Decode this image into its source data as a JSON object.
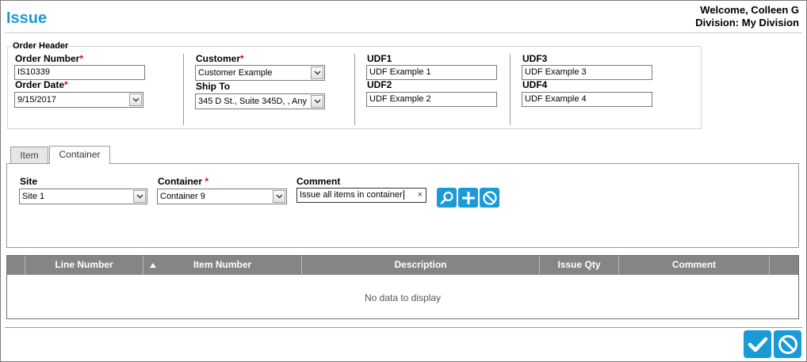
{
  "page": {
    "title": "Issue",
    "welcome": "Welcome, Colleen G",
    "division": "Division: My Division"
  },
  "order_header": {
    "legend": "Order Header",
    "order_number_label": "Order Number",
    "order_number": "IS10339",
    "order_date_label": "Order Date",
    "order_date": "9/15/2017",
    "customer_label": "Customer",
    "customer": "Customer Example",
    "ship_to_label": "Ship To",
    "ship_to": "345 D St., Suite 345D, , Any",
    "udf1_label": "UDF1",
    "udf1": "UDF Example 1",
    "udf2_label": "UDF2",
    "udf2": "UDF Example 2",
    "udf3_label": "UDF3",
    "udf3": "UDF Example 3",
    "udf4_label": "UDF4",
    "udf4": "UDF Example 4",
    "required_marker": "*"
  },
  "tabs": [
    {
      "label": "Item",
      "active": false
    },
    {
      "label": "Container",
      "active": true
    }
  ],
  "container_tab": {
    "site_label": "Site",
    "site": "Site 1",
    "container_label": "Container",
    "container": "Container 9",
    "comment_label": "Comment",
    "comment": "Issue all items in container",
    "clear_glyph": "×"
  },
  "grid": {
    "columns": [
      "Line Number",
      "Item Number",
      "Description",
      "Issue Qty",
      "Comment"
    ],
    "sorted_column": "Line Number",
    "empty_message": "No data to display",
    "rows": []
  },
  "icons": {
    "search": "search-icon",
    "add": "plus-icon",
    "cancel": "cancel-icon",
    "confirm": "checkmark-icon",
    "dropdown": "chevron-down-icon"
  },
  "colors": {
    "accent": "#1a9ad7",
    "required": "#e0001b",
    "grid_header": "#858585"
  }
}
